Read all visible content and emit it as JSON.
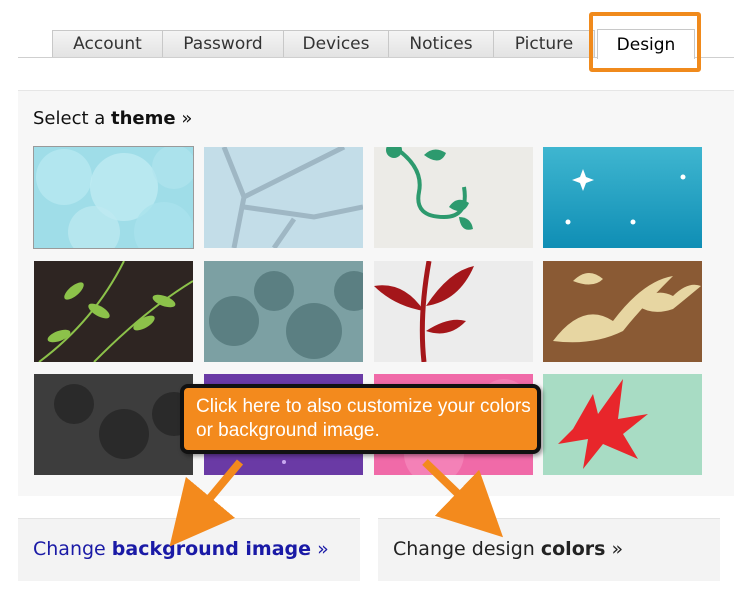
{
  "tabs": [
    {
      "label": "Account"
    },
    {
      "label": "Password"
    },
    {
      "label": "Devices"
    },
    {
      "label": "Notices"
    },
    {
      "label": "Picture"
    },
    {
      "label": "Design",
      "active": true
    }
  ],
  "theme_panel": {
    "title_prefix": "Select a ",
    "title_bold": "theme",
    "title_suffix": " »"
  },
  "themes": [
    {
      "name": "bubbles-blue",
      "selected": true
    },
    {
      "name": "bare-tree"
    },
    {
      "name": "green-vine"
    },
    {
      "name": "sparkle-teal"
    },
    {
      "name": "leaves-dark"
    },
    {
      "name": "foliage-gray"
    },
    {
      "name": "red-plant"
    },
    {
      "name": "birds-brown"
    },
    {
      "name": "trees-charcoal"
    },
    {
      "name": "purple-dots"
    },
    {
      "name": "pink-glow"
    },
    {
      "name": "red-leaf-mint"
    }
  ],
  "links": {
    "background_prefix": "Change ",
    "background_bold": "background image",
    "background_suffix": " »",
    "colors_prefix": "Change design ",
    "colors_bold": "colors",
    "colors_suffix": " »"
  },
  "callout": {
    "text": "Click here to also customize your colors or background image."
  },
  "colors": {
    "accent": "#f08a1c",
    "link_blue": "#1a1aa6"
  }
}
